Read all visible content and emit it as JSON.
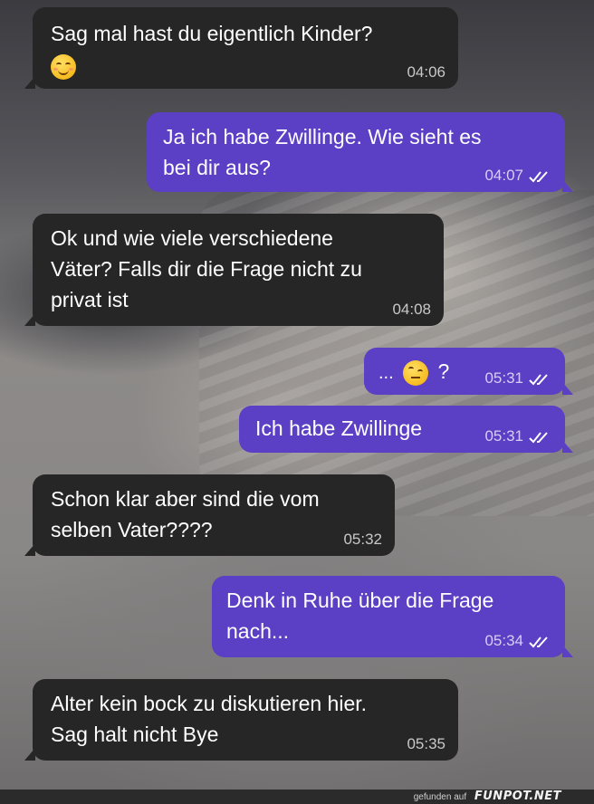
{
  "messages": [
    {
      "text_line1": "Sag mal hast du eigentlich Kinder?",
      "emoji": "smiling-face-emoji",
      "time": "04:06",
      "direction": "incoming"
    },
    {
      "text": "Ja ich habe Zwillinge. Wie sieht es\nbei dir aus?",
      "time": "04:07",
      "direction": "outgoing",
      "status": "read"
    },
    {
      "text": "Ok und wie viele verschiedene\nVäter? Falls dir die Frage nicht zu\nprivat ist",
      "time": "04:08",
      "direction": "incoming"
    },
    {
      "prefix": "...",
      "emoji": "face-with-raised-eyebrow-emoji",
      "suffix": "?",
      "time": "05:31",
      "direction": "outgoing",
      "status": "read"
    },
    {
      "text": "Ich habe Zwillinge",
      "time": "05:31",
      "direction": "outgoing",
      "status": "read"
    },
    {
      "text": "Schon klar aber sind die vom\nselben Vater????",
      "time": "05:32",
      "direction": "incoming"
    },
    {
      "text": "Denk in Ruhe über die Frage\nnach...",
      "time": "05:34",
      "direction": "outgoing",
      "status": "read"
    },
    {
      "text": "Alter kein bock zu diskutieren hier.\nSag halt nicht Bye",
      "time": "05:35",
      "direction": "incoming"
    }
  ],
  "footer": {
    "prefix": "gefunden auf",
    "brand": "FUNPOT.NET"
  },
  "colors": {
    "incoming_bubble": "#262626",
    "outgoing_bubble": "#5b3fc4",
    "text": "#ffffff"
  }
}
